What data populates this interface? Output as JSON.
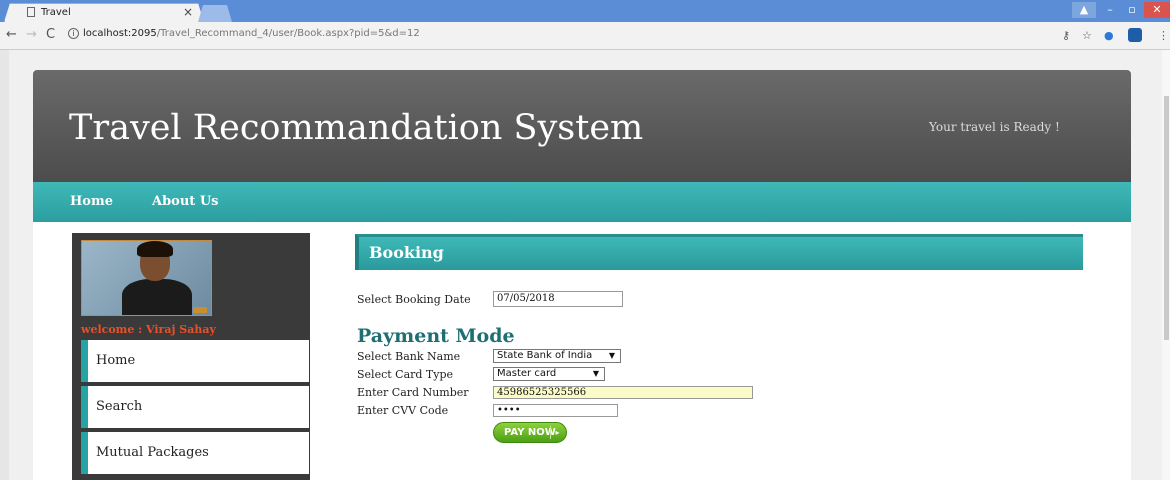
{
  "browser": {
    "tab_title": "Travel",
    "tab_close": "×",
    "url_host": "localhost:2095",
    "url_path": "/Travel_Recommand_4/user/Book.aspx?pid=5&d=12",
    "window_min": "–",
    "window_max": "▫",
    "window_close": "✕",
    "window_user": "▲"
  },
  "site": {
    "title": "Travel Recommandation System",
    "slogan": "Your travel is Ready !",
    "nav": [
      "Home",
      "About Us"
    ]
  },
  "sidebar": {
    "welcome": "welcome : Viraj Sahay",
    "items": [
      "Home",
      "Search",
      "Mutual Packages"
    ]
  },
  "main": {
    "panel_title": "Booking",
    "booking_date_label": "Select Booking Date",
    "booking_date_value": "07/05/2018",
    "payment_title": "Payment Mode",
    "bank_label": "Select Bank Name",
    "bank_value": "State Bank of India",
    "card_type_label": "Select Card Type",
    "card_type_value": "Master card",
    "card_number_label": "Enter Card Number",
    "card_number_value": "45986525325566",
    "cvv_label": "Enter CVV Code",
    "cvv_value": "••••",
    "pay_button": "PAY NOW"
  },
  "colors": {
    "teal": "#2ba1a3",
    "header_gray": "#5c5c5c",
    "welcome_orange": "#e8502a",
    "pay_green": "#6ab82a"
  }
}
